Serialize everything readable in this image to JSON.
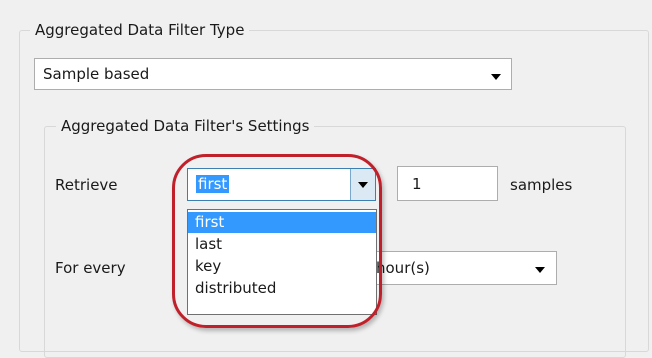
{
  "filter_type": {
    "group_label": "Aggregated Data Filter Type",
    "selected": "Sample based"
  },
  "settings": {
    "group_label": "Aggregated Data Filter's Settings",
    "retrieve_label": "Retrieve",
    "retrieve_selected": "first",
    "retrieve_options": [
      "first",
      "last",
      "key",
      "distributed"
    ],
    "count_value": "1",
    "count_unit": "samples",
    "every_label": "For every",
    "every_unit_selected": "hour(s)"
  },
  "colors": {
    "highlight": "#3399ff",
    "annotation_ring": "#c0202a"
  }
}
